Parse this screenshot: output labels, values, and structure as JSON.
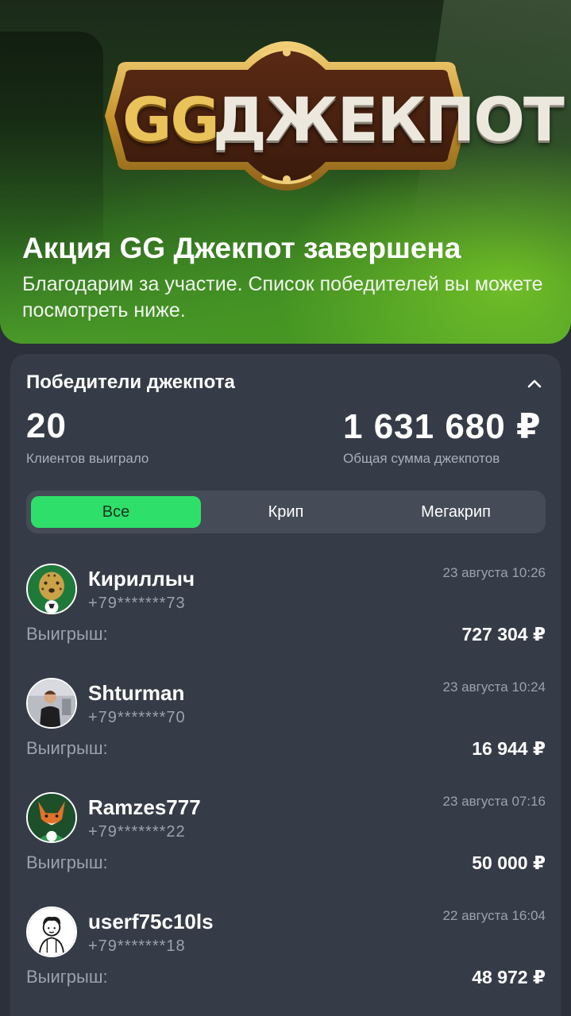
{
  "hero": {
    "logo_gg": "GG",
    "logo_word": "ДЖЕКПОТ",
    "title": "Акция GG Джекпот завершена",
    "subtitle": "Благодарим за участие. Список победителей вы можете посмотреть ниже."
  },
  "card": {
    "header": "Победители джекпота",
    "stats": {
      "clients_value": "20",
      "clients_label": "Клиентов выиграло",
      "total_value": "1 631 680 ₽",
      "total_label": "Общая сумма джекпотов"
    },
    "tabs": [
      {
        "label": "Все",
        "active": true
      },
      {
        "label": "Крип",
        "active": false
      },
      {
        "label": "Мегакрип",
        "active": false
      }
    ],
    "win_label": "Выигрыш:",
    "winners": [
      {
        "name": "Кириллыч",
        "phone": "+79*******73",
        "date": "23 августа 10:26",
        "amount": "727 304 ₽",
        "avatar": "leopard-avatar"
      },
      {
        "name": "Shturman",
        "phone": "+79*******70",
        "date": "23 августа 10:24",
        "amount": "16 944 ₽",
        "avatar": "photo-avatar"
      },
      {
        "name": "Ramzes777",
        "phone": "+79*******22",
        "date": "23 августа 07:16",
        "amount": "50 000 ₽",
        "avatar": "fox-avatar"
      },
      {
        "name": "userf75c10ls",
        "phone": "+79*******18",
        "date": "22 августа 16:04",
        "amount": "48 972 ₽",
        "avatar": "cartoon-avatar"
      }
    ]
  },
  "colors": {
    "background": "#2b303a",
    "card": "#363c47",
    "accent_green": "#2ee06a",
    "muted_text": "#9aa2ae"
  }
}
